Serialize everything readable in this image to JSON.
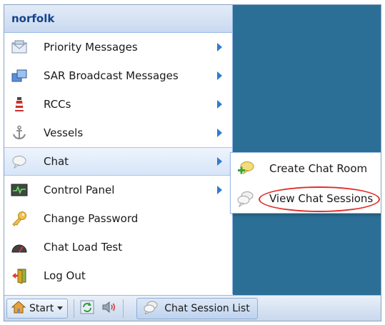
{
  "start_menu": {
    "header": "norfolk",
    "items": [
      {
        "label": "Priority Messages",
        "icon": "envelope-icon",
        "submenu": true
      },
      {
        "label": "SAR Broadcast Messages",
        "icon": "broadcast-windows-icon",
        "submenu": true
      },
      {
        "label": "RCCs",
        "icon": "lighthouse-icon",
        "submenu": true
      },
      {
        "label": "Vessels",
        "icon": "anchor-icon",
        "submenu": true
      },
      {
        "label": "Chat",
        "icon": "chat-bubble-icon",
        "submenu": true,
        "active": true
      },
      {
        "label": "Control Panel",
        "icon": "control-panel-icon",
        "submenu": true
      },
      {
        "label": "Change Password",
        "icon": "key-icon",
        "submenu": false
      },
      {
        "label": "Chat Load Test",
        "icon": "load-test-icon",
        "submenu": false
      },
      {
        "label": "Log Out",
        "icon": "logout-door-icon",
        "submenu": false
      }
    ]
  },
  "chat_submenu": {
    "items": [
      {
        "label": "Create Chat Room",
        "icon": "create-chat-room-icon"
      },
      {
        "label": "View Chat Sessions",
        "icon": "chat-sessions-icon",
        "highlighted": true
      }
    ]
  },
  "taskbar": {
    "start_label": "Start",
    "task_button_label": "Chat Session List"
  },
  "colors": {
    "desktop": "#2b6f96",
    "menu_header_text": "#15428b",
    "arrow": "#2f7bd1",
    "highlight_circle": "#e0302a"
  }
}
